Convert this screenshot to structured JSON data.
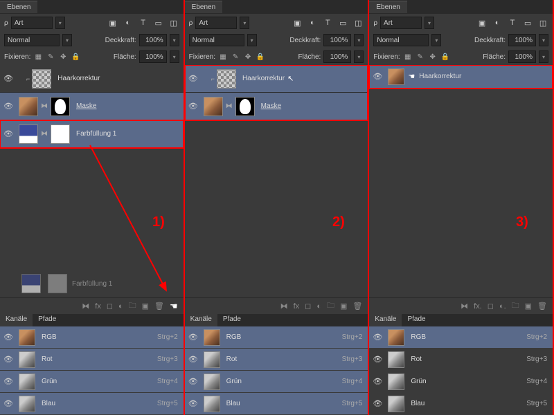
{
  "tabs": {
    "ebenen": "Ebenen",
    "kanale": "Kanäle",
    "pfade": "Pfade"
  },
  "search": {
    "label": "Art",
    "blend": "Normal"
  },
  "opacity": {
    "label": "Deckkraft:",
    "value": "100%"
  },
  "fill": {
    "label": "Fläche:",
    "value": "100%"
  },
  "lock": {
    "label": "Fixieren:"
  },
  "layers": {
    "haar": "Haarkorrektur",
    "maske": "Maske",
    "farb": "Farbfüllung 1"
  },
  "channels": {
    "rgb": {
      "name": "RGB",
      "key": "Strg+2"
    },
    "rot": {
      "name": "Rot",
      "key": "Strg+3"
    },
    "grun": {
      "name": "Grün",
      "key": "Strg+4"
    },
    "blau": {
      "name": "Blau",
      "key": "Strg+5"
    }
  },
  "steps": {
    "s1": "1)",
    "s2": "2)",
    "s3": "3)"
  }
}
